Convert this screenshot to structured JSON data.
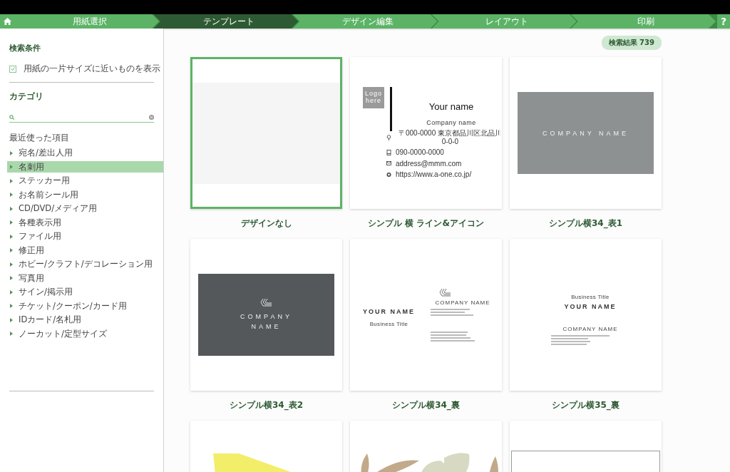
{
  "nav": {
    "steps": [
      {
        "label": "用紙選択",
        "selected": false
      },
      {
        "label": "テンプレート",
        "selected": true
      },
      {
        "label": "デザイン編集",
        "selected": false
      },
      {
        "label": "レイアウト",
        "selected": false
      },
      {
        "label": "印刷",
        "selected": false
      }
    ],
    "help": "?"
  },
  "sidebar": {
    "conditions_title": "検索条件",
    "filter": {
      "label": "用紙の一片サイズに近いものを表示",
      "checked": true
    },
    "category_title": "カテゴリ",
    "recent_label": "最近使った項目",
    "categories": [
      {
        "label": "宛名/差出人用",
        "selected": false
      },
      {
        "label": "名刺用",
        "selected": true
      },
      {
        "label": "ステッカー用",
        "selected": false
      },
      {
        "label": "お名前シール用",
        "selected": false
      },
      {
        "label": "CD/DVD/メディア用",
        "selected": false
      },
      {
        "label": "各種表示用",
        "selected": false
      },
      {
        "label": "ファイル用",
        "selected": false
      },
      {
        "label": "修正用",
        "selected": false
      },
      {
        "label": "ホビー/クラフト/デコレーション用",
        "selected": false
      },
      {
        "label": "写真用",
        "selected": false
      },
      {
        "label": "サイン/掲示用",
        "selected": false
      },
      {
        "label": "チケット/クーポン/カード用",
        "selected": false
      },
      {
        "label": "IDカード/名札用",
        "selected": false
      },
      {
        "label": "ノーカット/定型サイズ",
        "selected": false
      }
    ]
  },
  "results": {
    "count": "検索結果 739"
  },
  "templates": [
    {
      "kind": "blank",
      "name": "デザインなし",
      "selected": true
    },
    {
      "kind": "line-icon",
      "name": "シンプル 横 ライン&アイコン",
      "selected": false,
      "logo": "Logo here",
      "person": "Your name",
      "company": "Company name",
      "contacts": [
        {
          "kind": "pin",
          "text": "〒000-0000 東京都品川区北品川0-0-0"
        },
        {
          "kind": "phone",
          "text": "090-0000-0000"
        },
        {
          "kind": "mail",
          "text": "address@mmm.com"
        },
        {
          "kind": "globe",
          "text": "https://www.a-one.co.jp/"
        }
      ]
    },
    {
      "kind": "band",
      "name": "シンプル横34_表1",
      "selected": false,
      "company": "COMPANY NAME"
    },
    {
      "kind": "dark-logo",
      "name": "シンプル横34_表2",
      "selected": false,
      "company": "COMPANY NAME"
    },
    {
      "kind": "two-column",
      "name": "シンプル横34_裏",
      "selected": false,
      "person": "YOUR NAME",
      "title": "Business Title",
      "company": "COMPANY NAME"
    },
    {
      "kind": "left-stack",
      "name": "シンプル横35_裏",
      "selected": false,
      "person": "YOUR NAME",
      "title": "Business Title",
      "company": "COMPANY NAME"
    },
    {
      "kind": "yellow",
      "selected": false
    },
    {
      "kind": "leaves",
      "selected": false
    },
    {
      "kind": "frame",
      "selected": false
    }
  ]
}
